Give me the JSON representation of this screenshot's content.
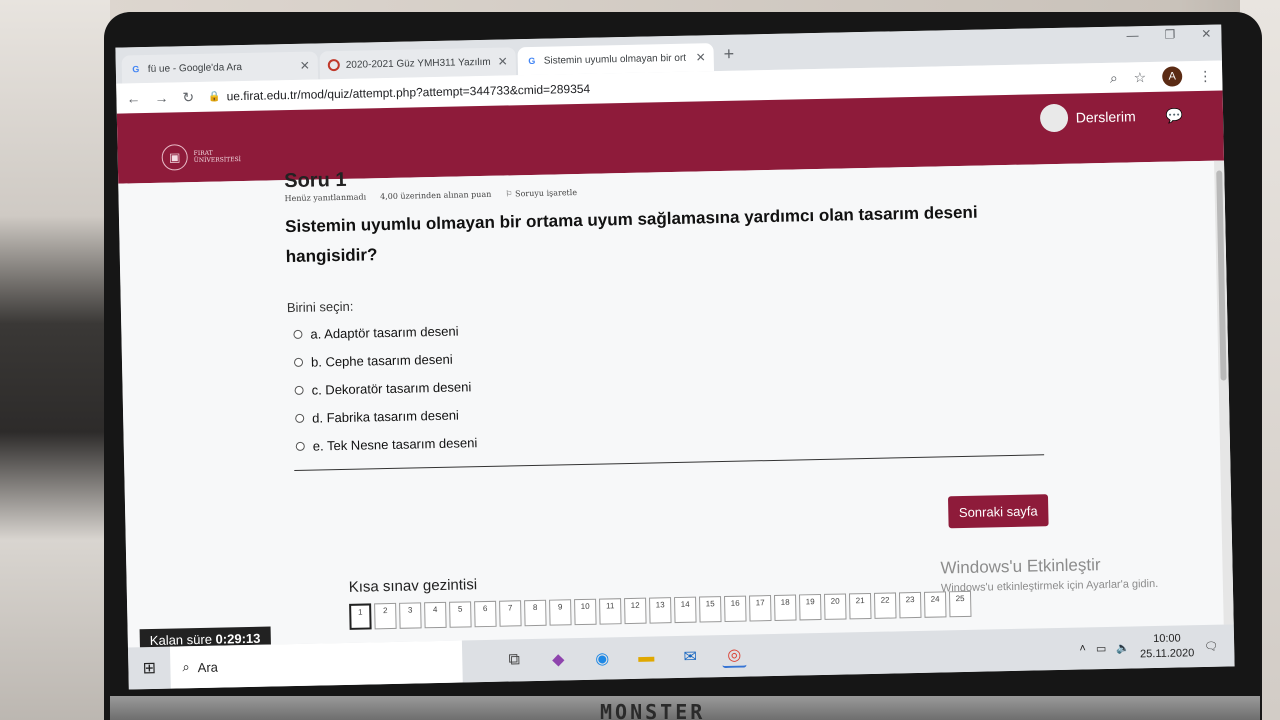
{
  "browser": {
    "tabs": [
      {
        "label": "fü ue - Google'da Ara",
        "icon": "google-icon"
      },
      {
        "label": "2020-2021 Güz YMH311 Yazılım",
        "icon": "moodle-icon"
      },
      {
        "label": "Sistemin uyumlu olmayan bir ort",
        "icon": "google-icon"
      }
    ],
    "url": "ue.firat.edu.tr/mod/quiz/attempt.php?attempt=344733&cmid=289354",
    "avatar_letter": "A"
  },
  "site": {
    "logo_line1": "FIRAT",
    "logo_line2": "ÜNİVERSİTESİ",
    "user_label": "Derslerim",
    "brand_color": "#8e1b3a"
  },
  "quiz": {
    "question_title": "Soru 1",
    "status": "Henüz yanıtlanmadı",
    "grade": "4,00 üzerinden alınan puan",
    "flag": "Soruyu işaretle",
    "question_text": "Sistemin uyumlu olmayan bir ortama uyum sağlamasına yardımcı olan tasarım deseni hangisidir?",
    "prompt": "Birini seçin:",
    "answers": [
      "a. Adaptör tasarım deseni",
      "b. Cephe tasarım deseni",
      "c. Dekoratör tasarım deseni",
      "d. Fabrika tasarım deseni",
      "e. Tek Nesne tasarım deseni"
    ],
    "next_button": "Sonraki sayfa",
    "nav_title": "Kısa sınav gezintisi",
    "nav_numbers": [
      "1",
      "2",
      "3",
      "4",
      "5",
      "6",
      "7",
      "8",
      "9",
      "10",
      "11",
      "12",
      "13",
      "14",
      "15",
      "16",
      "17",
      "18",
      "19",
      "20",
      "21",
      "22",
      "23",
      "24",
      "25"
    ],
    "timer_label": "Kalan süre",
    "timer_value": "0:29:13"
  },
  "windows": {
    "watermark_title": "Windows'u Etkinleştir",
    "watermark_sub": "Windows'u etkinleştirmek için Ayarlar'a gidin.",
    "search_label": "Ara",
    "time": "10:00",
    "date": "25.11.2020"
  },
  "laptop_brand": "MONSTER"
}
